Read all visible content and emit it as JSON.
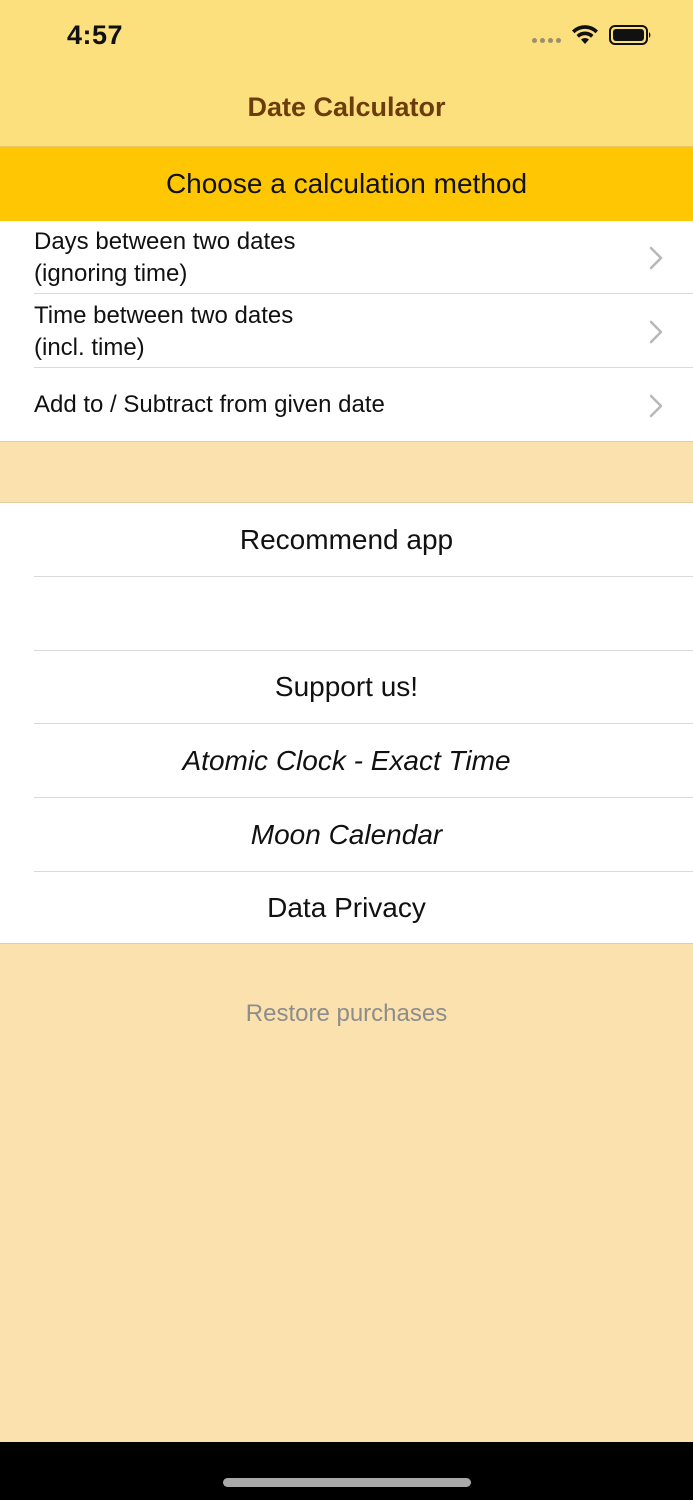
{
  "status_bar": {
    "time": "4:57",
    "icons": [
      "cellular-dots-icon",
      "wifi-icon",
      "battery-icon"
    ]
  },
  "nav": {
    "title": "Date Calculator"
  },
  "section": {
    "header": "Choose a calculation method"
  },
  "methods": [
    {
      "line1": "Days between two dates",
      "line2": "(ignoring time)"
    },
    {
      "line1": "Time between two dates",
      "line2": "(incl. time)"
    },
    {
      "line1": "Add to / Subtract from given date",
      "line2": ""
    }
  ],
  "links": {
    "recommend": "Recommend app",
    "blank": "",
    "support": "Support us!",
    "atomic_clock": "Atomic Clock - Exact Time",
    "moon_calendar": "Moon Calendar",
    "privacy": "Data Privacy"
  },
  "footer": {
    "restore": "Restore purchases"
  },
  "colors": {
    "nav_background": "#fde07e",
    "section_header": "#ffc603",
    "page_background": "#fbe1ad",
    "nav_title": "#6b3d0d",
    "restore_text": "#8d8d8d"
  }
}
